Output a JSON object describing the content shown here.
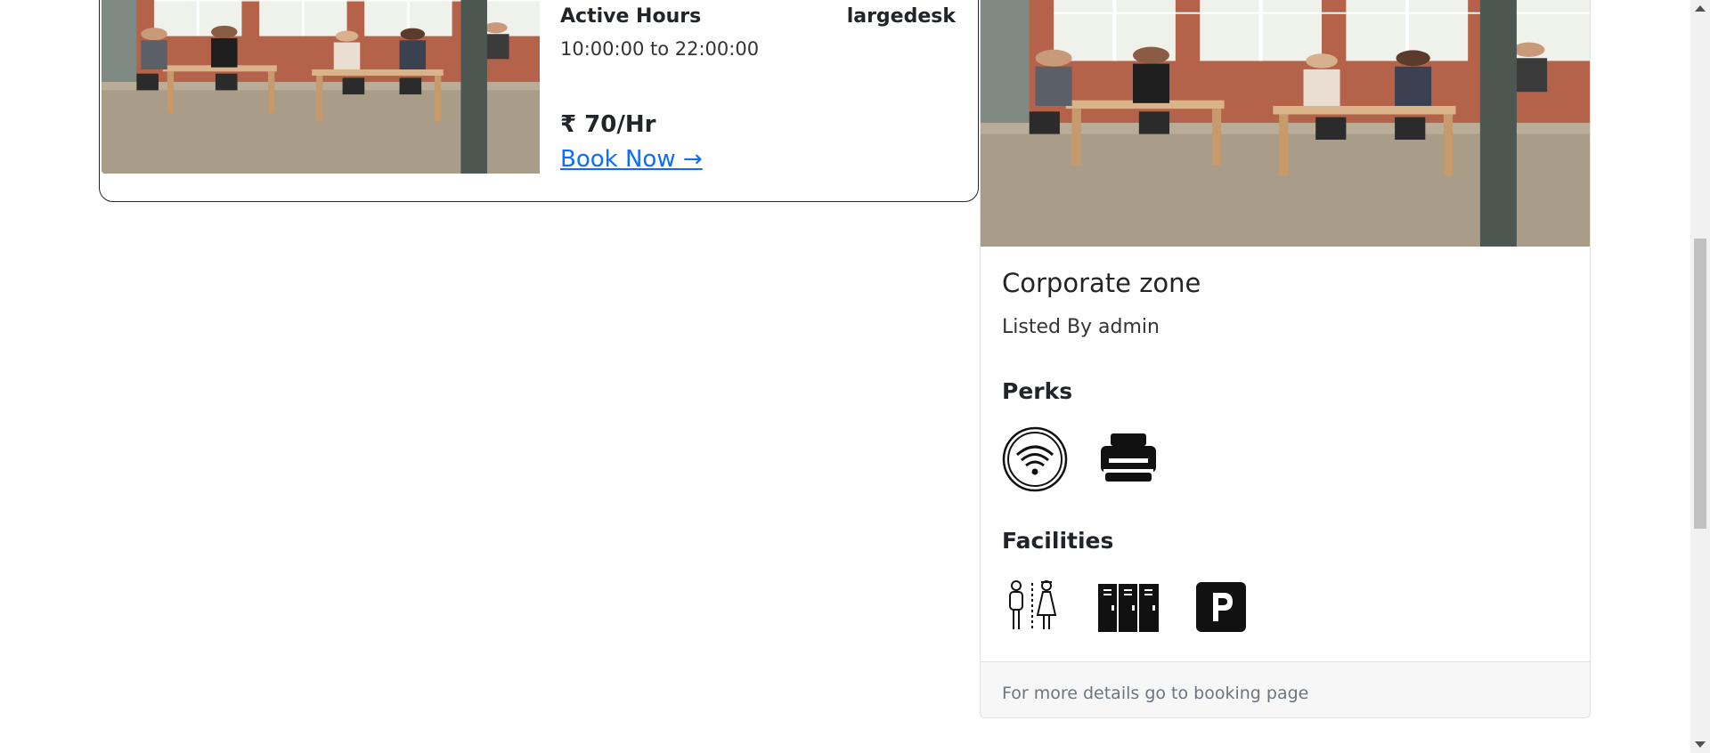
{
  "listing": {
    "title": "Active Hours",
    "desk_type": "largedesk",
    "hours": "10:00:00 to 22:00:00",
    "price": "₹ 70/Hr",
    "book_label": "Book Now →",
    "image": "coworking-office-photo"
  },
  "zone": {
    "title": "Corporate zone",
    "listed_by": "Listed By admin",
    "perks_heading": "Perks",
    "perks": [
      "wifi-icon",
      "printer-icon"
    ],
    "facilities_heading": "Facilities",
    "facilities": [
      "restroom-icon",
      "lockers-icon",
      "parking-icon"
    ],
    "footer": "For more details go to booking page",
    "image": "coworking-office-photo"
  },
  "colors": {
    "link": "#0d6efd",
    "text": "#212529",
    "muted": "#6c757d",
    "footer_bg": "#f7f7f7"
  }
}
